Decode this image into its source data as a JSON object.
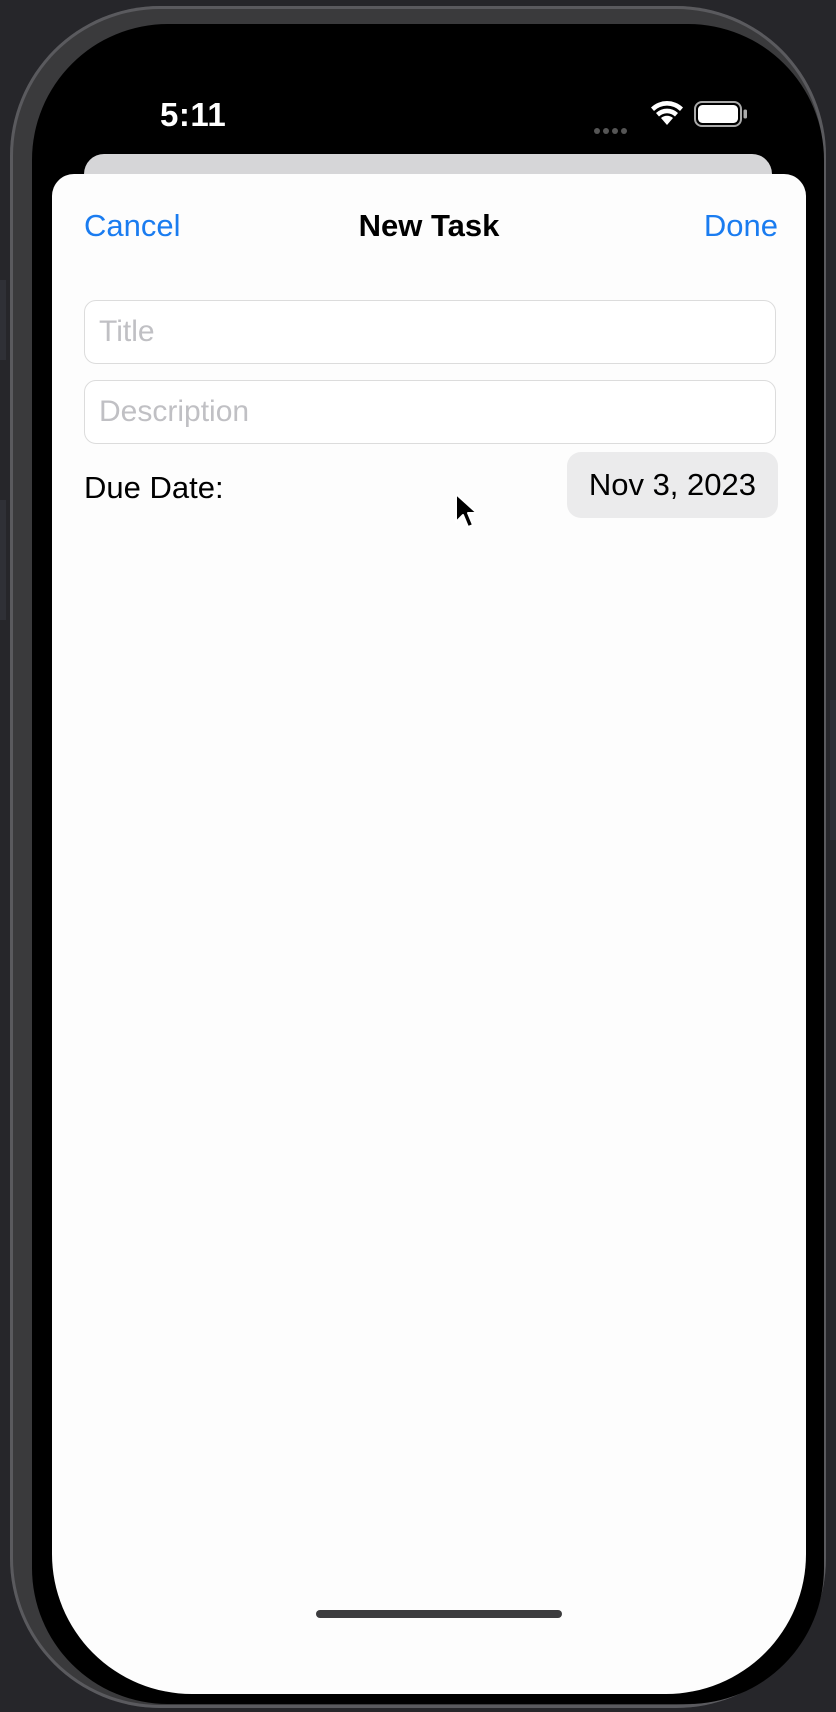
{
  "status_bar": {
    "time": "5:11",
    "wifi_icon": "wifi-icon",
    "battery_icon": "battery-icon"
  },
  "nav": {
    "cancel_label": "Cancel",
    "title": "New Task",
    "done_label": "Done"
  },
  "form": {
    "title_placeholder": "Title",
    "title_value": "",
    "description_placeholder": "Description",
    "description_value": "",
    "due_date_label": "Due Date:",
    "due_date_value": "Nov 3, 2023"
  },
  "colors": {
    "accent": "#1a7cf0",
    "sheet_background": "#fdfdfd",
    "date_pill_background": "#ebebec",
    "placeholder": "#c0c0c4"
  }
}
